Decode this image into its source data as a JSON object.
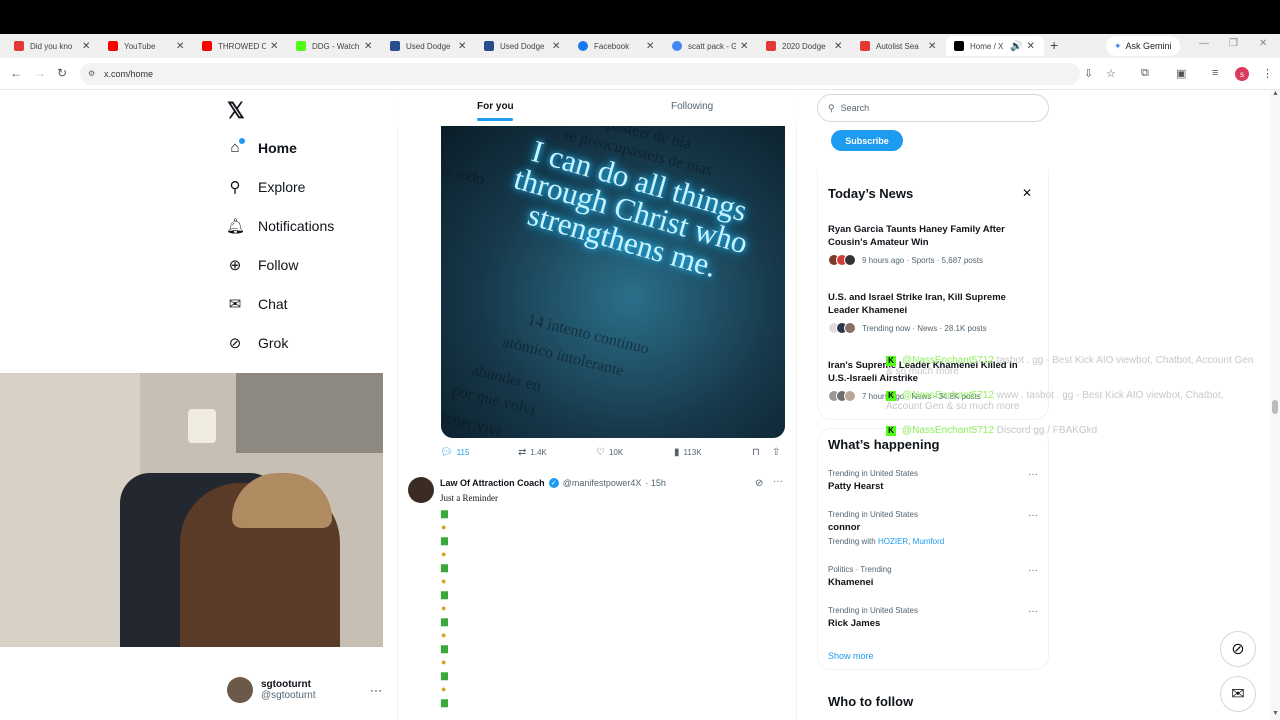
{
  "browser": {
    "tabs": [
      {
        "title": "Did you kno",
        "color": "#e53935"
      },
      {
        "title": "YouTube",
        "color": "#ff0000"
      },
      {
        "title": "THROWED O",
        "color": "#ff0000"
      },
      {
        "title": "DDG - Watch",
        "color": "#53fc18"
      },
      {
        "title": "Used Dodge",
        "color": "#2a4d8f"
      },
      {
        "title": "Used Dodge",
        "color": "#2a4d8f"
      },
      {
        "title": "Facebook",
        "color": "#1877f2"
      },
      {
        "title": "scatt pack - G",
        "color": "#4285f4"
      },
      {
        "title": "2020 Dodge",
        "color": "#e53935"
      },
      {
        "title": "Autolist Sea",
        "color": "#e53935"
      },
      {
        "title": "Home / X",
        "color": "#000000"
      }
    ],
    "ask_gemini": "Ask Gemini",
    "url": "x.com/home"
  },
  "nav": {
    "items": [
      {
        "label": "Home",
        "icon": "home-icon"
      },
      {
        "label": "Explore",
        "icon": "search-icon"
      },
      {
        "label": "Notifications",
        "icon": "bell-icon"
      },
      {
        "label": "Follow",
        "icon": "add-user-icon"
      },
      {
        "label": "Chat",
        "icon": "mail-icon"
      },
      {
        "label": "Grok",
        "icon": "grok-icon"
      }
    ]
  },
  "user": {
    "name": "sgtooturnt",
    "handle": "@sgtooturnt"
  },
  "feed": {
    "tabs": [
      "For you",
      "Following"
    ],
    "post1": {
      "image_text": "I can do all things through Christ who strengthens me.",
      "bg_lines": [
        "cupasteis de nía",
        "se preocupasteis de nias",
        "de todo",
        "14 intento continuo",
        "atómico intolerante",
        "abunder en",
        "por que volvi",
        "tener vivi"
      ],
      "replies": "115",
      "reposts": "1.4K",
      "likes": "10K",
      "views": "113K"
    },
    "post2": {
      "name": "Law Of Attraction Coach",
      "handle": "@manifestpower4X",
      "time": "· 15h",
      "text": "Just a Reminder"
    }
  },
  "right": {
    "search_placeholder": "Search",
    "subscribe": "Subscribe",
    "news_title": "Today’s News",
    "news": [
      {
        "headline": "Ryan Garcia Taunts Haney Family After Cousin's Amateur Win",
        "meta": "9 hours ago · Sports · 5,687 posts"
      },
      {
        "headline": "U.S. and Israel Strike Iran, Kill Supreme Leader Khamenei",
        "meta": "Trending now · News · 28.1K posts"
      },
      {
        "headline": "Iran's Supreme Leader Khamenei Killed in U.S.-Israeli Airstrike",
        "meta": "7 hours ago · News · 34.8K posts"
      }
    ],
    "happening_title": "What’s happening",
    "trends": [
      {
        "context": "Trending in United States",
        "topic": "Patty Hearst"
      },
      {
        "context": "Trending in United States",
        "topic": "connor",
        "with_label": "Trending with",
        "with": [
          "HOZIER",
          "Mumford"
        ]
      },
      {
        "context": "Politics · Trending",
        "topic": "Khamenei"
      },
      {
        "context": "Trending in United States",
        "topic": "Rick James"
      }
    ],
    "show_more": "Show more",
    "who_to_follow": "Who to follow"
  },
  "overlay": {
    "lines": [
      {
        "user": "@NassEnchant5712",
        "msg": "tasbot . gg - Best Kick AIO viewbot, Chatbot, Account Gen & so much more"
      },
      {
        "user": "@NassEnchant5712",
        "msg": "www . tasbot . gg - Best Kick AIO viewbot, Chatbot, Account Gen & so much more"
      },
      {
        "user": "@NassEnchant5712",
        "msg": "Discord gg / FBAKGkd"
      }
    ]
  }
}
